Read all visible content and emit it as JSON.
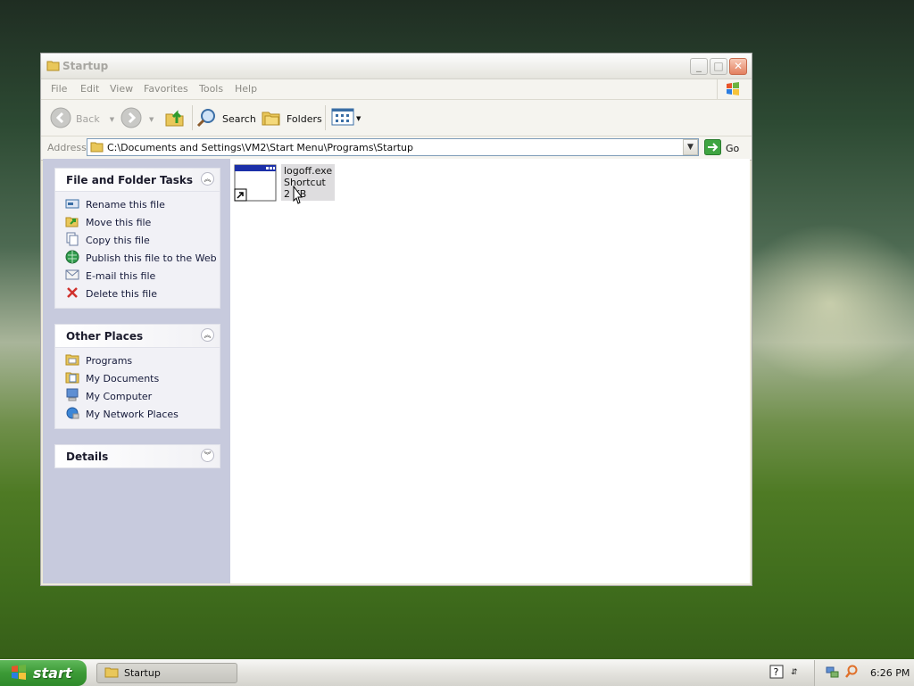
{
  "window": {
    "title": "Startup",
    "minimize_label": "_",
    "maximize_label": "□",
    "close_label": "✕"
  },
  "menu": {
    "items": [
      "File",
      "Edit",
      "View",
      "Favorites",
      "Tools",
      "Help"
    ]
  },
  "toolbar": {
    "back_label": "Back",
    "search_label": "Search",
    "folders_label": "Folders"
  },
  "address": {
    "label": "Address",
    "path": "C:\\Documents and Settings\\VM2\\Start Menu\\Programs\\Startup",
    "go_label": "Go"
  },
  "tasks": {
    "title": "File and Folder Tasks",
    "items": [
      {
        "label": "Rename this file",
        "icon": "rename-icon"
      },
      {
        "label": "Move this file",
        "icon": "move-icon"
      },
      {
        "label": "Copy this file",
        "icon": "copy-icon"
      },
      {
        "label": "Publish this file to the Web",
        "icon": "globe-icon"
      },
      {
        "label": "E-mail this file",
        "icon": "email-icon"
      },
      {
        "label": "Delete this file",
        "icon": "delete-icon"
      }
    ]
  },
  "places": {
    "title": "Other Places",
    "items": [
      {
        "label": "Programs",
        "icon": "folder-icon"
      },
      {
        "label": "My Documents",
        "icon": "documents-icon"
      },
      {
        "label": "My Computer",
        "icon": "computer-icon"
      },
      {
        "label": "My Network Places",
        "icon": "network-icon"
      }
    ]
  },
  "details": {
    "title": "Details"
  },
  "file": {
    "name": "logoff.exe",
    "type": "Shortcut",
    "size": "2 KB"
  },
  "taskbar": {
    "start_label": "start",
    "window_button": "Startup",
    "clock": "6:26 PM"
  },
  "colors": {
    "taskpane_bg": "#c7cadd",
    "start_green": "#3c9a36",
    "close_red": "#e3805f"
  }
}
